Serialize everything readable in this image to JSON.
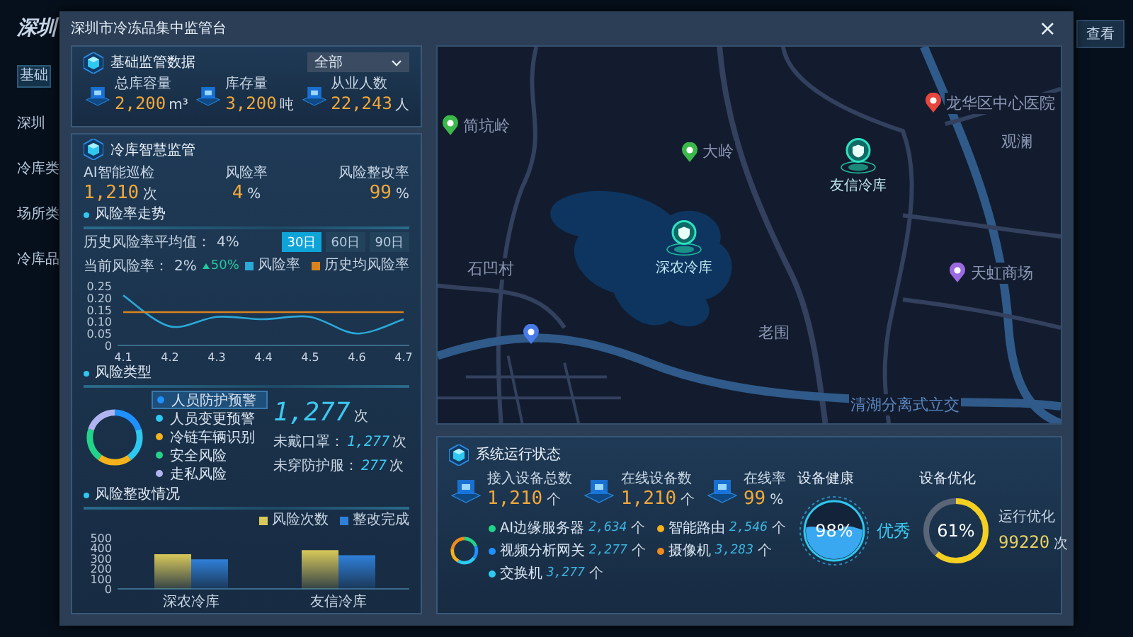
{
  "background": {
    "brand": "深圳",
    "filter": "基础",
    "location": "深圳",
    "sections": [
      "冷库类",
      "场所类",
      "冷库品"
    ],
    "view_button": "查看"
  },
  "window": {
    "title": "深圳市冷冻品集中监管台",
    "close": "×"
  },
  "basic_panel": {
    "title": "基础监管数据",
    "dropdown": "全部",
    "stats": [
      {
        "label": "总库容量",
        "value": "2,200",
        "unit": "m³"
      },
      {
        "label": "库存量",
        "value": "3,200",
        "unit": "吨"
      },
      {
        "label": "从业人数",
        "value": "22,243",
        "unit": "人"
      }
    ]
  },
  "monitor_panel": {
    "title": "冷库智慧监管",
    "stats": [
      {
        "label": "AI智能巡检",
        "value": "1,210",
        "unit": "次"
      },
      {
        "label": "风险率",
        "value": "4",
        "unit": "%"
      },
      {
        "label": "风险整改率",
        "value": "99",
        "unit": "%"
      }
    ],
    "trend": {
      "title": "风险率走势",
      "history_label": "历史风险率平均值：",
      "history_value": "4%",
      "current_label": "当前风险率：",
      "current_value": "2%",
      "change": "50%",
      "ranges": [
        {
          "label": "30日",
          "selected": true
        },
        {
          "label": "60日",
          "selected": false
        },
        {
          "label": "90日",
          "selected": false
        }
      ],
      "chart_data": {
        "type": "line",
        "categories": [
          "4.1",
          "4.2",
          "4.3",
          "4.4",
          "4.5",
          "4.6",
          "4.7"
        ],
        "series": [
          {
            "name": "风险率",
            "color": "#2aa8d8",
            "values": [
              0.21,
              0.08,
              0.12,
              0.11,
              0.12,
              0.05,
              0.11
            ]
          },
          {
            "name": "历史均风险率",
            "color": "#d9821e",
            "values": [
              0.14,
              0.14,
              0.14,
              0.14,
              0.14,
              0.14,
              0.14
            ]
          }
        ],
        "ylim": [
          0,
          0.25
        ],
        "yticks": [
          0,
          0.05,
          {
            "value": 0.1,
            "label": "0.10"
          },
          {
            "value": 0.15,
            "label": "0.15"
          },
          {
            "value": 0.2,
            "label": "0.20"
          },
          0.25
        ]
      }
    },
    "risk_types": {
      "title": "风险类型",
      "items": [
        {
          "label": "人员防护预警",
          "color": "#1e90ff",
          "selected": true
        },
        {
          "label": "人员变更预警",
          "color": "#2ec8f0",
          "selected": false
        },
        {
          "label": "冷链车辆识别",
          "color": "#f5b21c",
          "selected": false
        },
        {
          "label": "安全风险",
          "color": "#22d48a",
          "selected": false
        },
        {
          "label": "走私风险",
          "color": "#b0b4f0",
          "selected": false
        }
      ],
      "total": "1,277",
      "total_unit": "次",
      "details": [
        {
          "label": "未戴口罩：",
          "value": "1,277",
          "unit": "次"
        },
        {
          "label": "未穿防护服：",
          "value": "277",
          "unit": "次"
        }
      ]
    },
    "rectification": {
      "title": "风险整改情况",
      "chart_data": {
        "type": "bar",
        "categories": [
          "深农冷库",
          "友信冷库"
        ],
        "series": [
          {
            "name": "风险次数",
            "color": "#d8c85a",
            "values": [
              340,
              380
            ]
          },
          {
            "name": "整改完成",
            "color": "#2f7fd8",
            "values": [
              290,
              330
            ]
          }
        ],
        "ylim": [
          0,
          500
        ],
        "yticks": [
          0,
          100,
          200,
          300,
          400,
          500
        ]
      }
    }
  },
  "map": {
    "places": [
      {
        "name": "简坑岭",
        "kind": "pin",
        "color": "#3cb84a"
      },
      {
        "name": "大岭",
        "kind": "pin",
        "color": "#3cb84a"
      },
      {
        "name": "龙华区中心医院",
        "kind": "pin",
        "color": "#e8453c"
      },
      {
        "name": "观澜",
        "kind": "area"
      },
      {
        "name": "石凹村",
        "kind": "area"
      },
      {
        "name": "老围",
        "kind": "area"
      },
      {
        "name": "天虹商场",
        "kind": "pin",
        "color": "#9b6ae0"
      },
      {
        "name": "清湖分离式立交",
        "kind": "road"
      }
    ],
    "warehouses": [
      {
        "name": "深农冷库"
      },
      {
        "name": "友信冷库"
      }
    ]
  },
  "system_panel": {
    "title": "系统运行状态",
    "stats": [
      {
        "label": "接入设备总数",
        "value": "1,210",
        "unit": "个"
      },
      {
        "label": "在线设备数",
        "value": "1,210",
        "unit": "个"
      },
      {
        "label": "在线率",
        "value": "99",
        "unit": "%"
      }
    ],
    "devices": [
      {
        "label": "AI边缘服务器",
        "value": "2,634",
        "unit": "个",
        "color": "#22d48a"
      },
      {
        "label": "视频分析网关",
        "value": "2,277",
        "unit": "个",
        "color": "#1e90ff"
      },
      {
        "label": "交换机",
        "value": "3,277",
        "unit": "个",
        "color": "#2ec8f0"
      },
      {
        "label": "智能路由",
        "value": "2,546",
        "unit": "个",
        "color": "#f5b21c"
      },
      {
        "label": "摄像机",
        "value": "3,283",
        "unit": "个",
        "color": "#f08a1c"
      }
    ],
    "health": {
      "title": "设备健康",
      "level": 0.98,
      "reading": "98%",
      "rating": "优秀"
    },
    "optimization": {
      "title": "设备优化",
      "level": 0.61,
      "reading": "61%",
      "label": "运行优化",
      "value": "99220",
      "unit": "次"
    }
  }
}
